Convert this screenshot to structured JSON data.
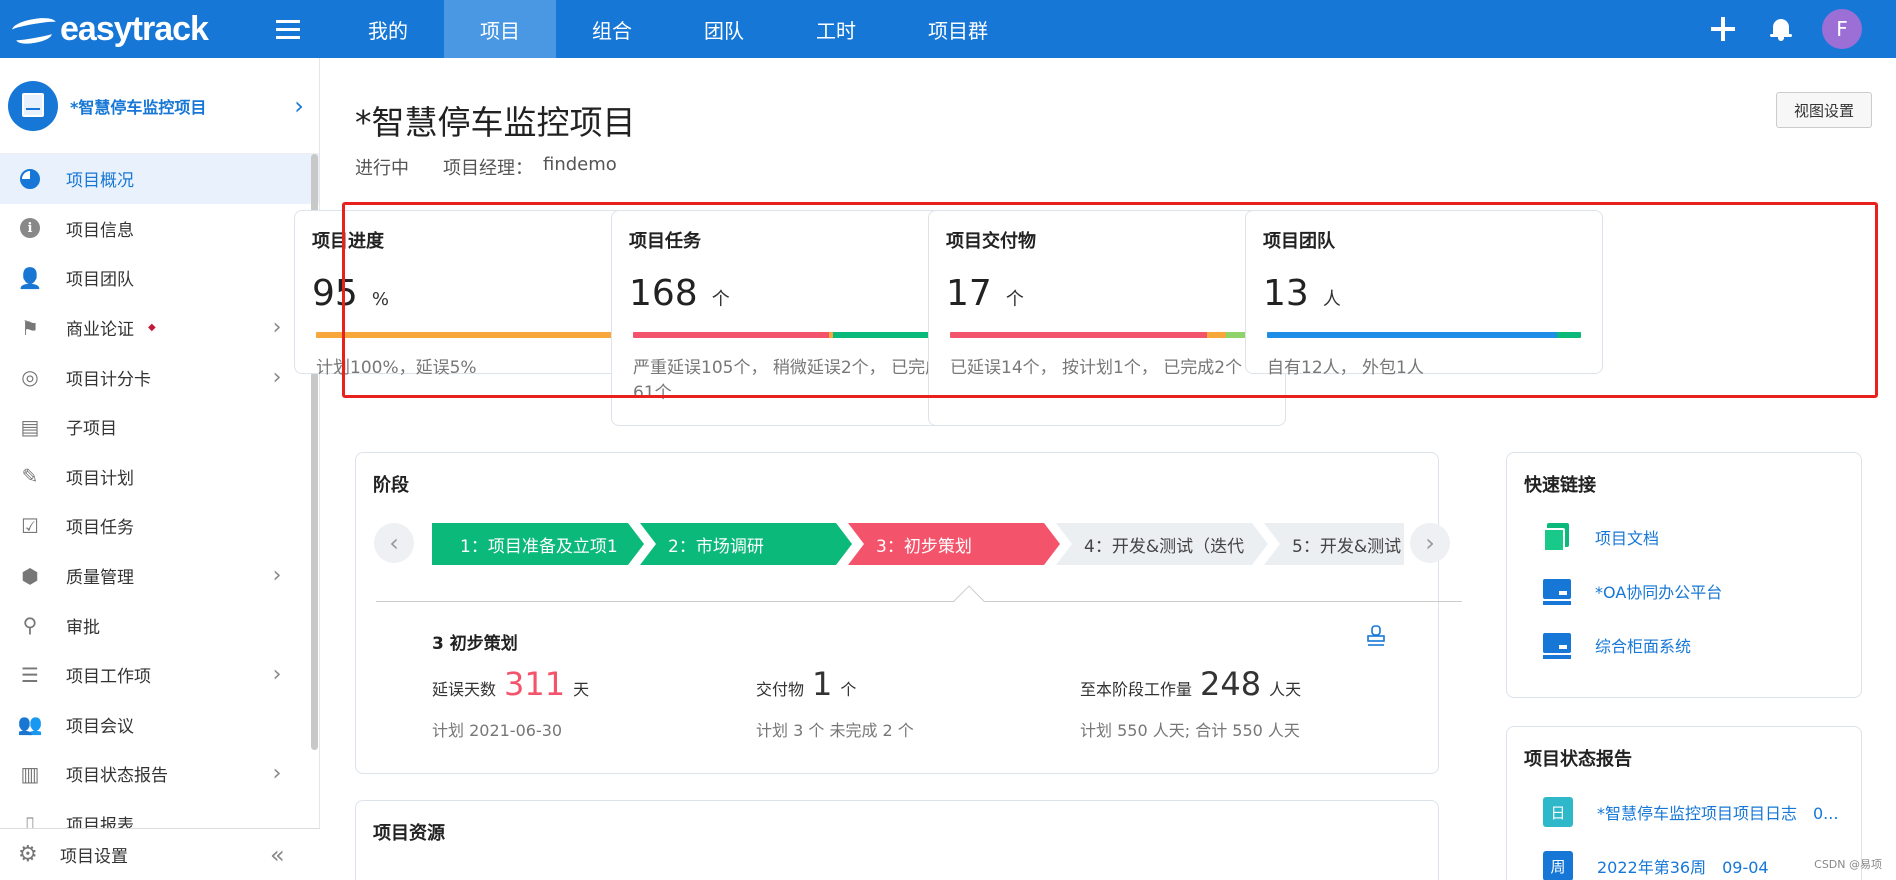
{
  "topbar": {
    "logo_text": "easytrack",
    "nav": [
      "我的",
      "项目",
      "组合",
      "团队",
      "工时",
      "项目群"
    ],
    "active_nav": 1,
    "avatar_letter": "F"
  },
  "sidebar": {
    "project_name": "*智慧停车监控项目",
    "items": [
      {
        "label": "项目概况",
        "icon": "pie-chart-icon",
        "active": true
      },
      {
        "label": "项目信息",
        "icon": "info-icon"
      },
      {
        "label": "项目团队",
        "icon": "team-icon"
      },
      {
        "label": "商业论证",
        "icon": "flag-icon",
        "dot": "◆",
        "chevron": true
      },
      {
        "label": "项目计分卡",
        "icon": "scorecard-icon",
        "chevron": true
      },
      {
        "label": "子项目",
        "icon": "subproject-icon"
      },
      {
        "label": "项目计划",
        "icon": "plan-icon"
      },
      {
        "label": "项目任务",
        "icon": "task-icon"
      },
      {
        "label": "质量管理",
        "icon": "quality-icon",
        "chevron": true
      },
      {
        "label": "审批",
        "icon": "approval-icon"
      },
      {
        "label": "项目工作项",
        "icon": "workitem-icon",
        "chevron": true
      },
      {
        "label": "项目会议",
        "icon": "meeting-icon"
      },
      {
        "label": "项目状态报告",
        "icon": "status-report-icon",
        "chevron": true
      },
      {
        "label": "项目报表",
        "icon": "report-icon"
      }
    ],
    "footer_label": "项目设置"
  },
  "main": {
    "title": "*智慧停车监控项目",
    "view_settings": "视图设置",
    "status": "进行中",
    "manager_label": "项目经理：",
    "manager": "findemo"
  },
  "stats": [
    {
      "title": "项目进度",
      "value": "95",
      "unit": "%",
      "desc": "计划100%，延误5%",
      "bar": [
        {
          "frac": 0.95,
          "color": "#f8a83a"
        }
      ]
    },
    {
      "title": "项目任务",
      "value": "168",
      "unit": "个",
      "desc": "严重延误105个， 稍微延误2个， 已完成61个",
      "bar": [
        {
          "frac": 0.625,
          "color": "#f4546b"
        },
        {
          "frac": 0.012,
          "color": "#f8a83a"
        },
        {
          "frac": 0.363,
          "color": "#0bb97a"
        }
      ]
    },
    {
      "title": "项目交付物",
      "value": "17",
      "unit": "个",
      "desc": "已延误14个， 按计划1个， 已完成2个",
      "bar": [
        {
          "frac": 0.82,
          "color": "#f4546b"
        },
        {
          "frac": 0.06,
          "color": "#f8a83a"
        },
        {
          "frac": 0.12,
          "color": "#8fd36b"
        }
      ]
    },
    {
      "title": "项目团队",
      "value": "13",
      "unit": "人",
      "desc": "自有12人， 外包1人",
      "bar": [
        {
          "frac": 0.923,
          "color": "#1e8ee6"
        },
        {
          "frac": 0.077,
          "color": "#0bb97a"
        }
      ]
    }
  ],
  "phase_panel": {
    "title": "阶段",
    "phases": [
      {
        "label": "1：项目准备及立项1",
        "status": "green"
      },
      {
        "label": "2：市场调研",
        "status": "green"
      },
      {
        "label": "3：初步策划",
        "status": "red"
      },
      {
        "label": "4：开发&测试（迭代",
        "status": "grey"
      },
      {
        "label": "5：开发&测试",
        "status": "grey"
      }
    ],
    "current_name": "3 初步策划",
    "delay_label": "延误天数",
    "delay_value": "311",
    "delay_unit": "天",
    "delay_sub": "计划 2021-06-30",
    "deliv_label": "交付物",
    "deliv_value": "1",
    "deliv_unit": "个",
    "deliv_sub": "计划 3 个  未完成 2 个",
    "work_label": "至本阶段工作量",
    "work_value": "248",
    "work_unit": "人天",
    "work_sub": "计划 550 人天; 合计 550 人天"
  },
  "resource_panel": {
    "title": "项目资源"
  },
  "quick_links": {
    "title": "快速链接",
    "items": [
      "项目文档",
      "*OA协同办公平台",
      "综合柜面系统"
    ]
  },
  "status_reports": {
    "title": "项目状态报告",
    "items": [
      {
        "badge": "日",
        "text": "*智慧停车监控项目项目日志　0..."
      },
      {
        "badge": "周",
        "text": "2022年第36周　09-04"
      }
    ]
  },
  "watermark": "CSDN @易项"
}
